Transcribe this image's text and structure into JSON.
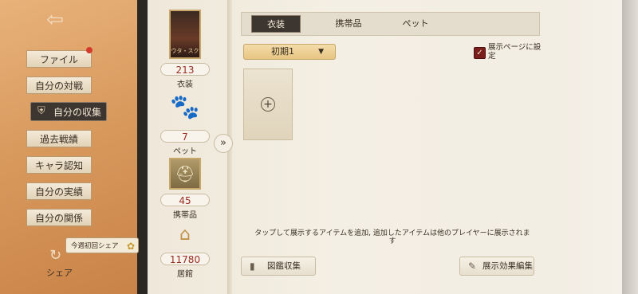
{
  "nav": {
    "items": [
      {
        "label": "ファイル"
      },
      {
        "label": "自分の対戦"
      },
      {
        "label": "自分の収集"
      },
      {
        "label": "過去戦績"
      },
      {
        "label": "キャラ認知"
      },
      {
        "label": "自分の実績"
      },
      {
        "label": "自分の関係"
      }
    ],
    "active_index": 2,
    "share_tip": "今週初回シェア",
    "share_label": "シェア"
  },
  "stats": {
    "costume": {
      "count": "213",
      "label": "衣装",
      "card_name": "ウタ・スク"
    },
    "pet": {
      "count": "7",
      "label": "ペット"
    },
    "item": {
      "count": "45",
      "label": "携帯品"
    },
    "house": {
      "count": "11780",
      "label": "居館"
    }
  },
  "tabs": [
    {
      "label": "衣装"
    },
    {
      "label": "携帯品"
    },
    {
      "label": "ペット"
    }
  ],
  "active_tab": 0,
  "filter": {
    "selected": "初期1"
  },
  "show_on_page": {
    "label": "展示ページに設定",
    "checked": true
  },
  "hint": "タップして展示するアイテムを追加, 追加したアイテムは他のプレイヤーに展示されます",
  "buttons": {
    "atlas": "図鑑収集",
    "edit_effect": "展示効果編集"
  },
  "colors": {
    "accent_dark": "#3d3530",
    "count_red": "#9a2c22",
    "checkbox_red": "#7a1e1c"
  }
}
